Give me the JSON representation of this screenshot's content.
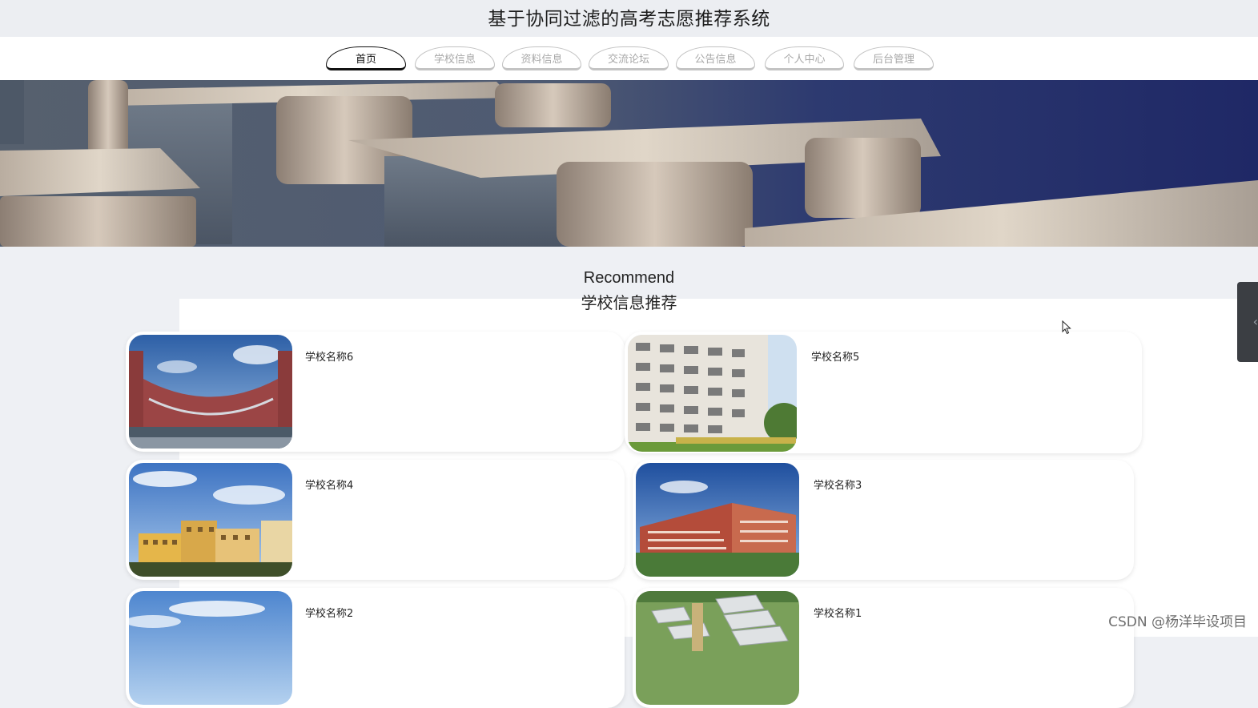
{
  "header": {
    "title": "基于协同过滤的高考志愿推荐系统"
  },
  "nav": {
    "tabs": [
      {
        "label": "首页",
        "active": true
      },
      {
        "label": "学校信息",
        "active": false
      },
      {
        "label": "资料信息",
        "active": false
      },
      {
        "label": "交流论坛",
        "active": false
      },
      {
        "label": "公告信息",
        "active": false
      },
      {
        "label": "个人中心",
        "active": false
      },
      {
        "label": "后台管理",
        "active": false
      }
    ]
  },
  "section": {
    "title_en": "Recommend",
    "title_cn": "学校信息推荐"
  },
  "schools": [
    {
      "name": "学校名称6"
    },
    {
      "name": "学校名称5"
    },
    {
      "name": "学校名称4"
    },
    {
      "name": "学校名称3"
    },
    {
      "name": "学校名称2"
    },
    {
      "name": "学校名称1"
    }
  ],
  "side_tab": {
    "icon": "chevron-left-icon"
  },
  "watermark": "CSDN @杨洋毕设项目",
  "colors": {
    "page_bg": "#eef0f4",
    "nav_active": "#111111",
    "nav_inactive": "#a8a8a8",
    "side_tab": "#3b3e43"
  }
}
